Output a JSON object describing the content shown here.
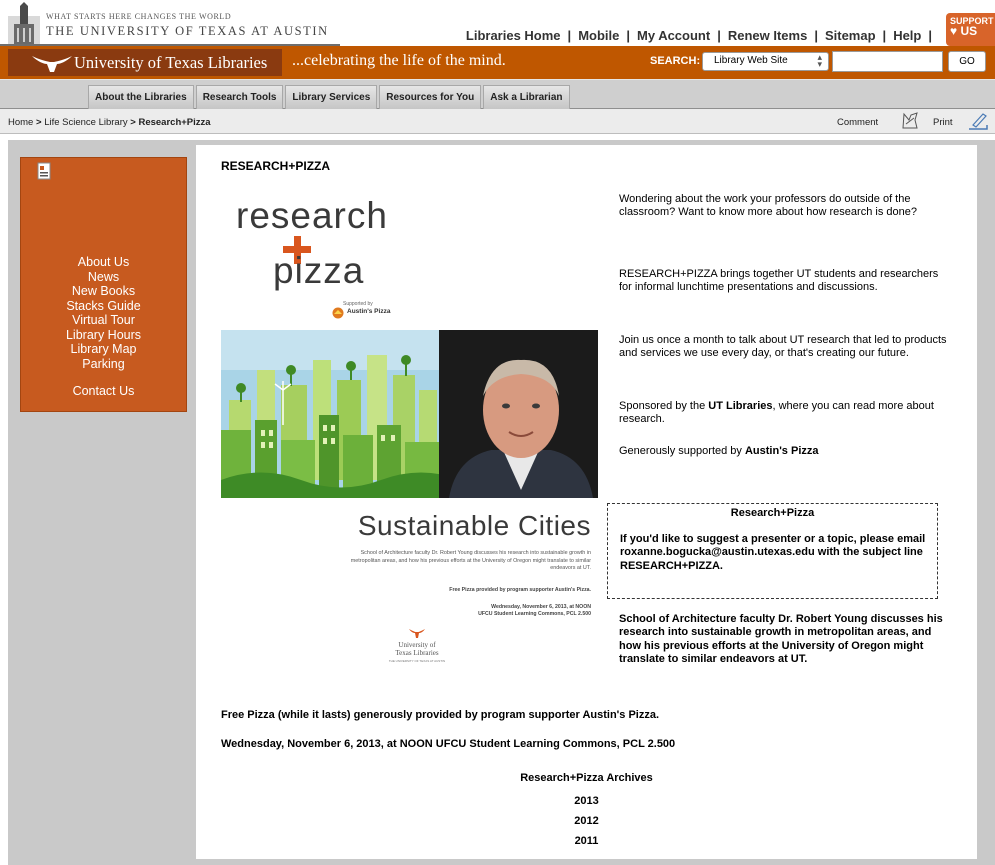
{
  "header": {
    "tagline": "What Starts Here Changes The World",
    "university_name": "The University of Texas at Austin",
    "top_links": [
      "Libraries Home",
      "Mobile",
      "My Account",
      "Renew Items",
      "Sitemap",
      "Help"
    ],
    "support_line1": "SUPPORT",
    "support_line2": "US"
  },
  "banner": {
    "title": "University of Texas Libraries",
    "motto": "...celebrating the life of the mind.",
    "search_label": "SEARCH:",
    "search_scope": "Library Web Site",
    "search_value": "",
    "search_button": "GO",
    "accent_color": "#bf5700"
  },
  "nav": {
    "tabs": [
      "About the Libraries",
      "Research Tools",
      "Library Services",
      "Resources for You",
      "Ask a Librarian"
    ]
  },
  "breadcrumb": {
    "home": "Home",
    "sep": ">",
    "section": "Life Science Library",
    "current": "Research+Pizza",
    "comment": "Comment",
    "print": "Print"
  },
  "sidebar": {
    "items": [
      "About Us",
      "News",
      "New Books",
      "Stacks Guide",
      "Virtual Tour",
      "Library Hours",
      "Library Map",
      "Parking"
    ],
    "contact": "Contact Us"
  },
  "main": {
    "title": "RESEARCH+PIZZA",
    "poster": {
      "word1": "research",
      "word2": "pizza",
      "supported_by": "Supported by",
      "sponsor": "Austin's Pizza",
      "subtitle": "Sustainable Cities",
      "description": "School of Architecture faculty Dr. Robert Young discusses his research into sustainable growth in metropolitan areas, and how his previous efforts at the University of Oregon might translate to similar endeavors at UT.",
      "free_pizza": "Free Pizza provided by program supporter Austin's Pizza.",
      "when_line1": "Wednesday, November 6, 2013, at NOON",
      "when_line2": "UFCU Student Learning Commons, PCL 2.500",
      "library_line1": "University of",
      "library_line2": "Texas Libraries",
      "library_sub": "THE UNIVERSITY OF TEXAS AT AUSTIN"
    },
    "para1": "Wondering about the work your professors do outside of the classroom? Want to know more about how research is done?",
    "para2": "RESEARCH+PIZZA brings together UT students and researchers for informal lunchtime presentations and discussions.",
    "para3": "Join us once a month to talk about UT research that led to products and services we use every day, or that's creating our future.",
    "para4_pre": "Sponsored by the ",
    "para4_bold": "UT Libraries",
    "para4_post": ", where you can read more about research.",
    "para5_pre": "Generously supported by ",
    "para5_bold": "Austin's Pizza",
    "suggest_title": "Research+Pizza",
    "suggest_text": "If you'd like to suggest a presenter or a topic, please email roxanne.bogucka@austin.utexas.edu with the subject line RESEARCH+PIZZA.",
    "speaker_desc": "School of Architecture faculty Dr. Robert Young discusses his research into sustainable growth in metropolitan areas, and how his previous efforts at the University of Oregon might translate to similar endeavors at UT.",
    "free_pizza": "Free Pizza (while it lasts) generously provided by program supporter Austin's Pizza.",
    "event": "Wednesday, November 6, 2013, at NOON UFCU Student Learning Commons, PCL 2.500",
    "archives_title": "Research+Pizza Archives",
    "archives": [
      "2013",
      "2012",
      "2011"
    ]
  }
}
